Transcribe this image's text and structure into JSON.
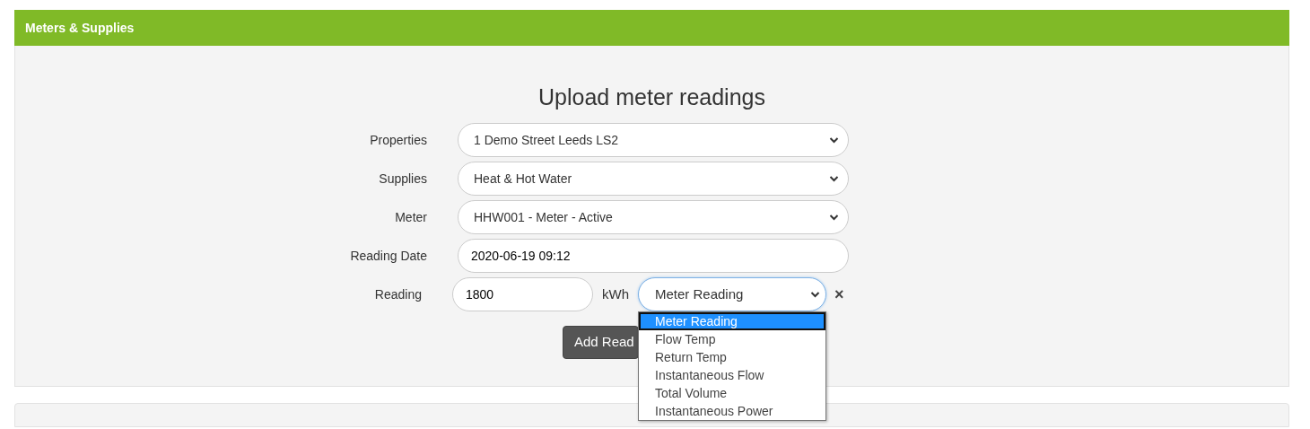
{
  "panel": {
    "title": "Meters & Supplies"
  },
  "form": {
    "heading": "Upload meter readings",
    "fields": [
      {
        "label": "Properties",
        "kind": "select",
        "value": "1 Demo Street Leeds LS2"
      },
      {
        "label": "Supplies",
        "kind": "select",
        "value": "Heat & Hot Water"
      },
      {
        "label": "Meter",
        "kind": "select",
        "value": "HHW001 - Meter - Active"
      },
      {
        "label": "Reading Date",
        "kind": "input",
        "value": "2020-06-19 09:12"
      }
    ],
    "reading": {
      "label": "Reading",
      "value": "1800",
      "unit": "kWh",
      "type_value": "Meter Reading",
      "remove": "×",
      "expanded": true,
      "options": [
        {
          "label": "Meter Reading",
          "selected": true
        },
        {
          "label": "Flow Temp",
          "selected": false
        },
        {
          "label": "Return Temp",
          "selected": false
        },
        {
          "label": "Instantaneous Flow",
          "selected": false
        },
        {
          "label": "Total Volume",
          "selected": false
        },
        {
          "label": "Instantaneous Power",
          "selected": false
        }
      ]
    },
    "submit": "Add Read"
  }
}
